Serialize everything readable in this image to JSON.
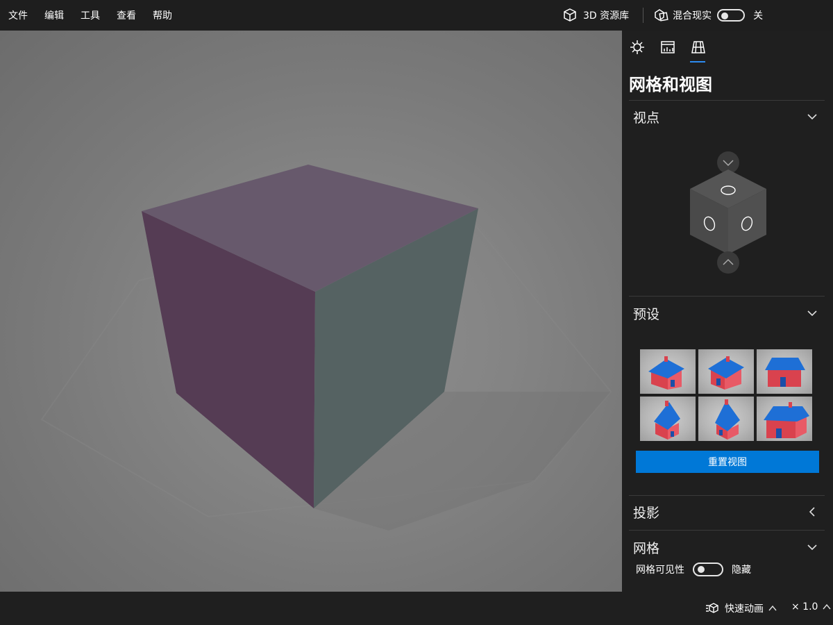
{
  "menu": {
    "items": [
      "文件",
      "编辑",
      "工具",
      "查看",
      "帮助"
    ]
  },
  "top_right": {
    "library_label": "3D 资源库",
    "mixed_reality_label": "混合现实",
    "mixed_reality_state": "关"
  },
  "panel": {
    "title": "网格和视图",
    "tabs": [
      "lighting-icon",
      "stats-icon",
      "grid-view-icon"
    ],
    "sections": {
      "viewpoint": "视点",
      "presets": "预设",
      "projection": "投影",
      "grid": "网格"
    },
    "reset_button": "重置视图",
    "grid_visibility_label": "网格可见性",
    "grid_visibility_state": "隐藏"
  },
  "status": {
    "animation_label": "快速动画",
    "speed": "× 1.0"
  },
  "colors": {
    "accent": "#0078d7",
    "panel_bg": "#1f1f1f",
    "cube_top": "#67596c",
    "cube_left": "#553c54",
    "cube_right": "#556262"
  }
}
